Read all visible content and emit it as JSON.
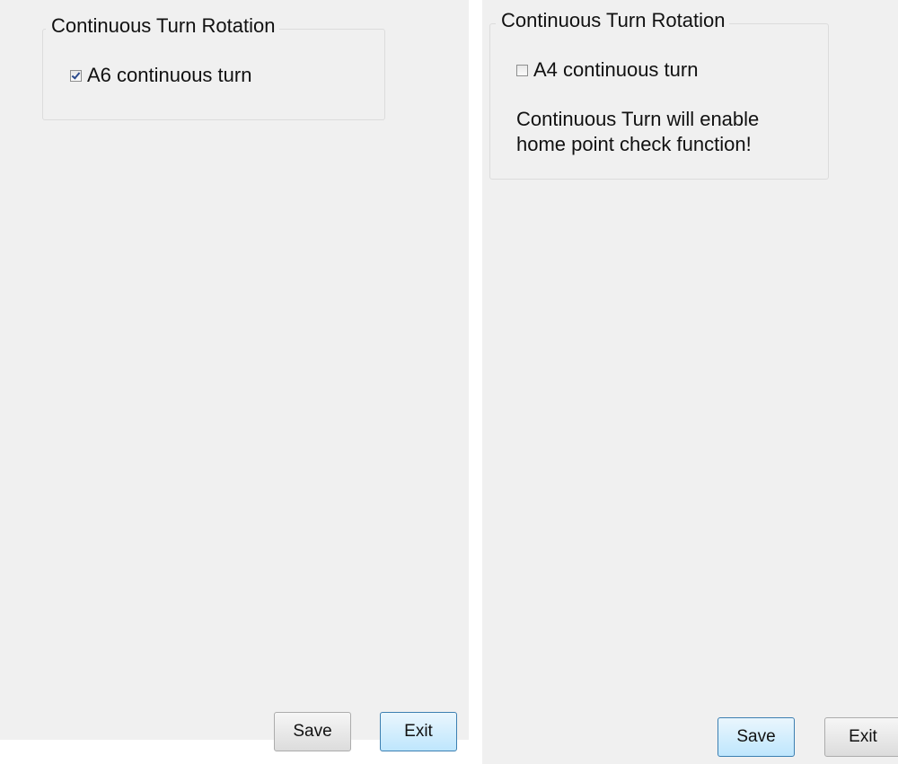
{
  "left_panel": {
    "group_title": "Continuous Turn Rotation",
    "checkbox": {
      "label": "A6 continuous turn",
      "checked": true
    },
    "buttons": {
      "save": "Save",
      "exit": "Exit"
    },
    "default_button": "exit"
  },
  "right_panel": {
    "group_title": "Continuous Turn Rotation",
    "checkbox": {
      "label": "A4 continuous turn",
      "checked": false
    },
    "note": "Continuous Turn will enable home point check function!",
    "buttons": {
      "save": "Save",
      "exit": "Exit"
    },
    "default_button": "save"
  },
  "colors": {
    "panel_background": "#f0f0f0",
    "default_button_border": "#3c7fb1",
    "default_button_fill": "#bee6fd"
  }
}
